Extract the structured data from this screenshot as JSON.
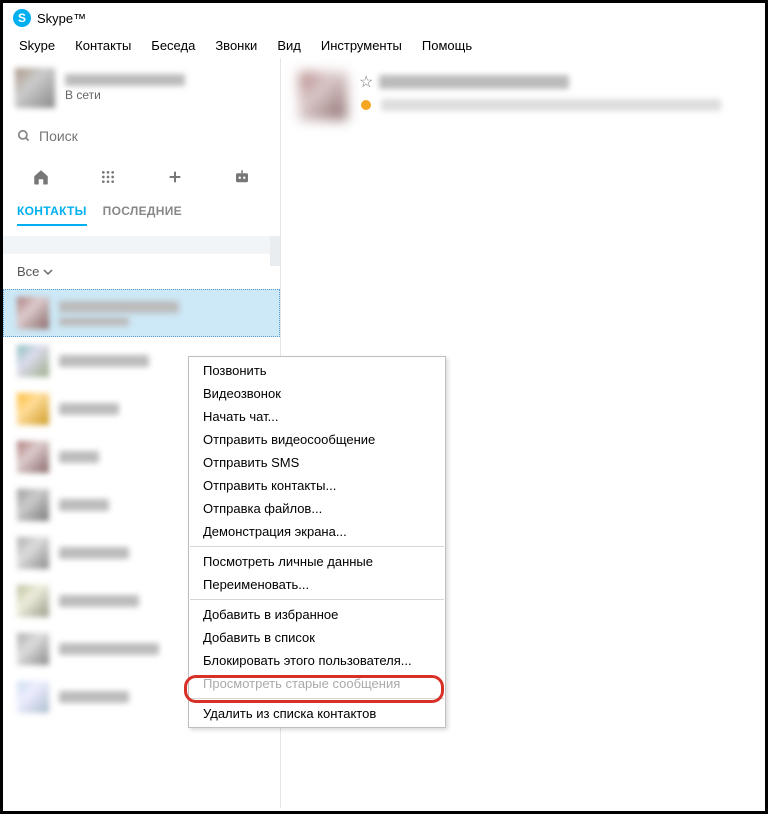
{
  "titlebar": {
    "app_name": "Skype™"
  },
  "menubar": {
    "items": [
      "Skype",
      "Контакты",
      "Беседа",
      "Звонки",
      "Вид",
      "Инструменты",
      "Помощь"
    ]
  },
  "profile": {
    "status": "В сети"
  },
  "search": {
    "placeholder": "Поиск"
  },
  "tabs": {
    "contacts": "КОНТАКТЫ",
    "recent": "ПОСЛЕДНИЕ"
  },
  "filter": {
    "label": "Все"
  },
  "context_menu": {
    "items": [
      {
        "label": "Позвонить",
        "enabled": true
      },
      {
        "label": "Видеозвонок",
        "enabled": true
      },
      {
        "label": "Начать чат...",
        "enabled": true
      },
      {
        "label": "Отправить видеосообщение",
        "enabled": true
      },
      {
        "label": "Отправить SMS",
        "enabled": true
      },
      {
        "label": "Отправить контакты...",
        "enabled": true
      },
      {
        "label": "Отправка файлов...",
        "enabled": true
      },
      {
        "label": "Демонстрация экрана...",
        "enabled": true
      },
      {
        "sep": true
      },
      {
        "label": "Посмотреть личные данные",
        "enabled": true
      },
      {
        "label": "Переименовать...",
        "enabled": true
      },
      {
        "sep": true
      },
      {
        "label": "Добавить в избранное",
        "enabled": true
      },
      {
        "label": "Добавить в список",
        "enabled": true
      },
      {
        "label": "Блокировать этого пользователя...",
        "enabled": true
      },
      {
        "label": "Просмотреть старые сообщения",
        "enabled": false
      },
      {
        "sep": true
      },
      {
        "label": "Удалить из списка контактов",
        "enabled": true,
        "highlighted": true
      }
    ]
  }
}
